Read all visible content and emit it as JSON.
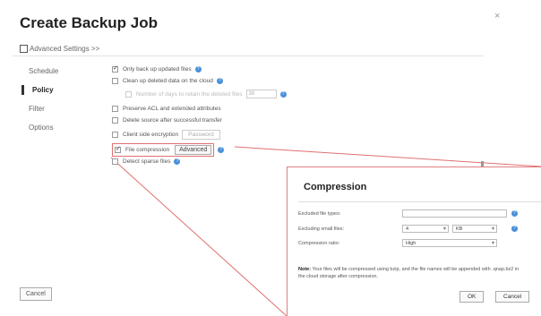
{
  "dialog": {
    "title": "Create Backup Job",
    "close_glyph": "×",
    "advanced_settings_label": "Advanced Settings >>",
    "cancel_label": "Cancel"
  },
  "sidebar": {
    "items": [
      {
        "label": "Schedule",
        "active": false
      },
      {
        "label": "Policy",
        "active": true
      },
      {
        "label": "Filter",
        "active": false
      },
      {
        "label": "Options",
        "active": false
      }
    ]
  },
  "policy": {
    "only_updated": "Only back up updated files",
    "clean_deleted": "Clean up deleted data on the cloud",
    "days_label": "Number of days to retain the deleted files",
    "days_value": "30",
    "preserve_acl": "Preserve ACL and extended attributes",
    "delete_source": "Delete source after successful transfer",
    "client_encryption": "Client side encryption",
    "password_button": "Password",
    "file_compression": "File compression",
    "advanced_button": "Advanced",
    "detect_sparse": "Detect sparse files"
  },
  "compression": {
    "title": "Compression",
    "excluded_label": "Excluded file types:",
    "excluded_value": "",
    "small_files_label": "Excluding small files:",
    "small_files_value": "4",
    "small_files_unit": "KB",
    "ratio_label": "Compression ratio:",
    "ratio_value": "High",
    "note_prefix": "Note:",
    "note_text": "Your files will be compressed using bzip, and the file names will be appended with .qnap.bz2 in the cloud storage after compression.",
    "ok_label": "OK",
    "cancel_label": "Cancel"
  },
  "colors": {
    "highlight_red": "#e07070",
    "help_blue": "#4a90d9"
  }
}
